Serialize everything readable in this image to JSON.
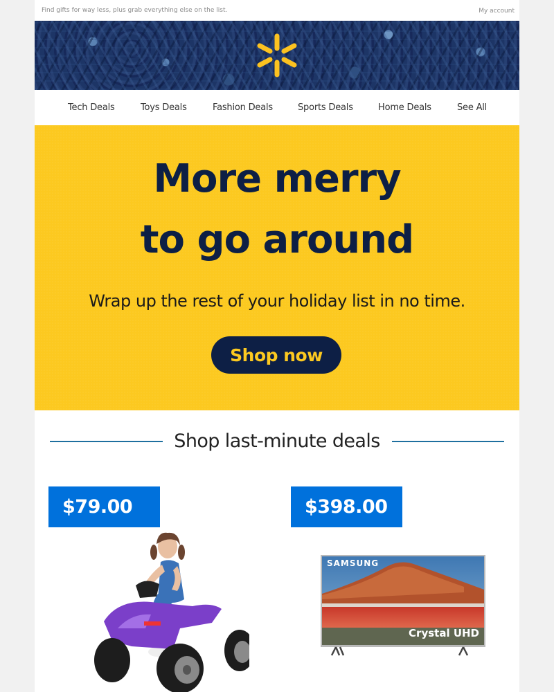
{
  "preheader": {
    "tagline": "Find gifts for way less, plus grab everything else on the list.",
    "account_link": "My account"
  },
  "banner": {
    "logo_icon": "walmart-spark-icon",
    "colors": {
      "background": "#1c3364",
      "spark": "#fcc220"
    }
  },
  "nav": {
    "items": [
      {
        "label": "Tech Deals"
      },
      {
        "label": "Toys Deals"
      },
      {
        "label": "Fashion Deals"
      },
      {
        "label": "Sports Deals"
      },
      {
        "label": "Home Deals"
      },
      {
        "label": "See All"
      }
    ]
  },
  "hero": {
    "headline_line1": "More merry",
    "headline_line2": "to go around",
    "subheadline": "Wrap up the rest of your holiday list in no time.",
    "cta_label": "Shop now",
    "colors": {
      "background": "#fcc920",
      "text": "#0d1f45"
    }
  },
  "section": {
    "title": "Shop last-minute deals",
    "rule_color": "#1e6f9f"
  },
  "products": [
    {
      "price": "$79.00",
      "image_alt": "Girl riding a purple kids ride-on ATV quad"
    },
    {
      "price": "$398.00",
      "image_alt": "Samsung Crystal UHD TV",
      "brand_text": "SAMSUNG",
      "screen_text": "Crystal UHD"
    }
  ],
  "price_badge_color": "#0071dc"
}
